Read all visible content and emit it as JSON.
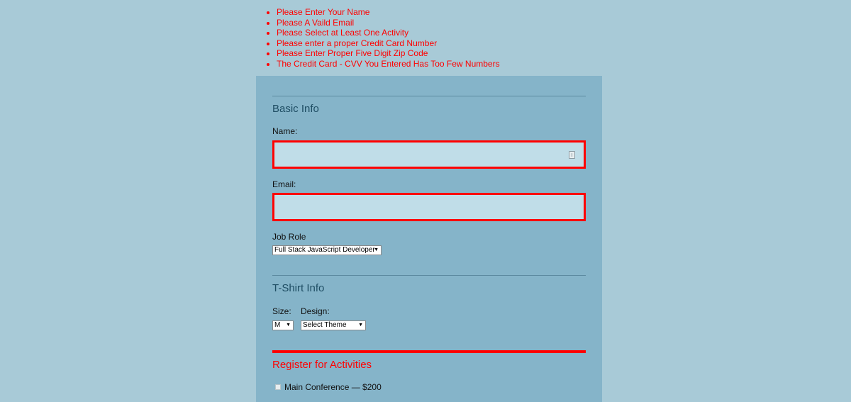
{
  "errors": [
    "Please Enter Your Name",
    "Please A Vaild Email",
    "Please Select at Least One Activity",
    "Please enter a proper Credit Card Number",
    "Please Enter Proper Five Digit Zip Code",
    "The Credit Card - CVV You Entered Has Too Few Numbers"
  ],
  "basic_info": {
    "legend": "Basic Info",
    "name_label": "Name:",
    "name_value": "",
    "email_label": "Email:",
    "email_value": "",
    "job_role_label": "Job Role",
    "job_role_selected": "Full Stack JavaScript Developer"
  },
  "tshirt_info": {
    "legend": "T-Shirt Info",
    "size_label": "Size:",
    "size_selected": "M",
    "design_label": "Design:",
    "design_selected": "Select Theme"
  },
  "activities": {
    "legend": "Register for Activities",
    "items": [
      {
        "label": "Main Conference — $200",
        "checked": false
      }
    ]
  },
  "colors": {
    "page_bg": "#a8cad7",
    "panel_bg": "#85b4c9",
    "error": "#ff0000",
    "legend": "#1e4d63",
    "input_bg": "#c0dde8"
  },
  "icons": {
    "dropdown": "triangle-down",
    "autofill": "autofill-key-icon"
  }
}
